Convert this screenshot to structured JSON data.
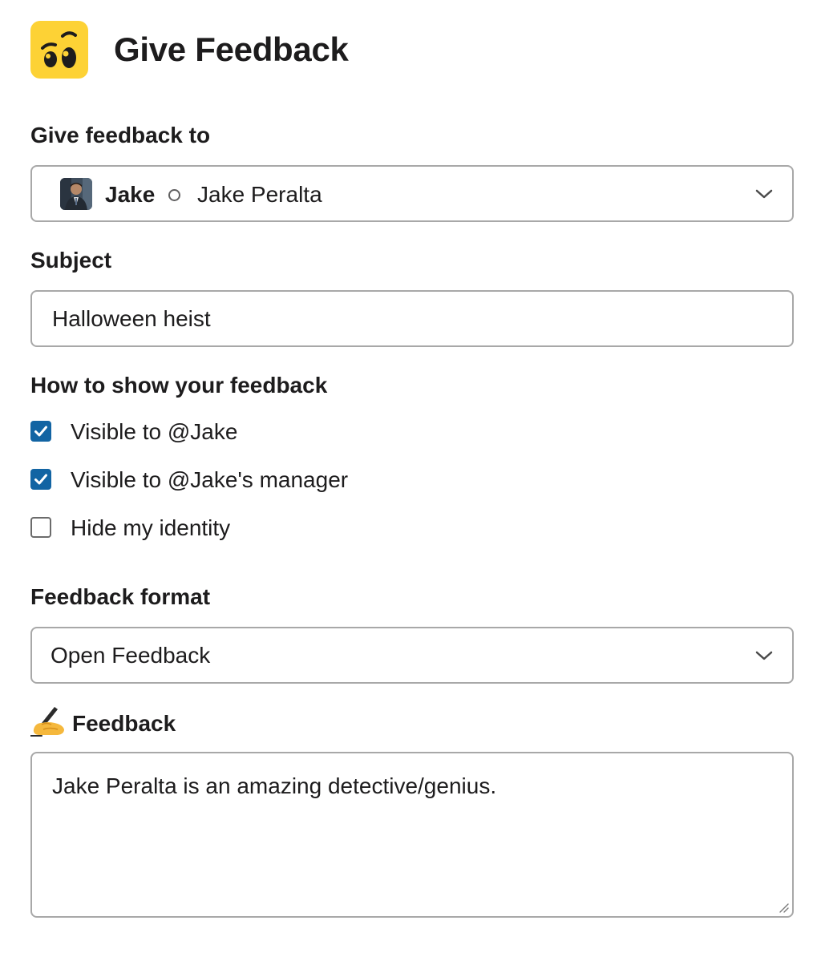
{
  "header": {
    "title": "Give Feedback",
    "app_icon": "eyes-emoji-icon",
    "app_icon_color": "#FDD235"
  },
  "recipient": {
    "label": "Give feedback to",
    "display_name": "Jake",
    "full_name": "Jake Peralta",
    "avatar": "user-avatar",
    "presence": "away"
  },
  "subject": {
    "label": "Subject",
    "value": "Halloween heist"
  },
  "visibility": {
    "label": "How to show your feedback",
    "options": [
      {
        "label": "Visible to @Jake",
        "checked": true
      },
      {
        "label": "Visible to @Jake's manager",
        "checked": true
      },
      {
        "label": "Hide my identity",
        "checked": false
      }
    ]
  },
  "format": {
    "label": "Feedback format",
    "value": "Open Feedback"
  },
  "feedback": {
    "label": "Feedback",
    "icon": "writing-hand-icon",
    "value": "Jake Peralta is an amazing detective/genius."
  },
  "colors": {
    "checkbox_accent": "#1264A3",
    "border": "#A8A8A8",
    "text": "#1D1C1D"
  }
}
